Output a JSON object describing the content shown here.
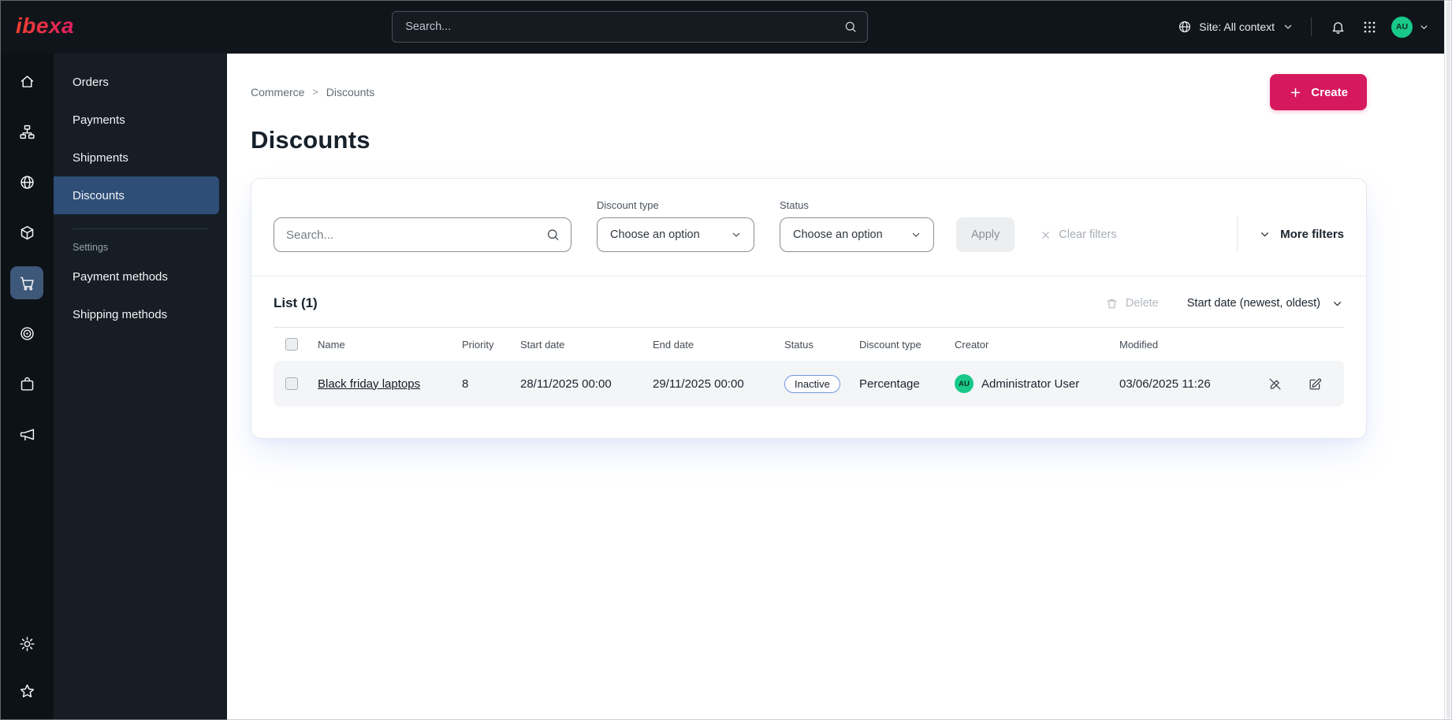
{
  "topbar": {
    "logo": "ibexa",
    "search_placeholder": "Search...",
    "site_context": "Site: All context",
    "user_initials": "AU"
  },
  "sidebar": {
    "rail_icons": [
      "home-icon",
      "sitemap-icon",
      "globe-icon",
      "box-icon",
      "cart-icon",
      "target-icon",
      "bag-icon",
      "megaphone-icon",
      "gear-icon",
      "star-icon"
    ],
    "active_icon": "cart-icon",
    "menu": {
      "items": [
        "Orders",
        "Payments",
        "Shipments",
        "Discounts"
      ],
      "active_item": "Discounts",
      "section_label": "Settings",
      "section_items": [
        "Payment methods",
        "Shipping methods"
      ]
    }
  },
  "main": {
    "breadcrumb": {
      "items": [
        "Commerce",
        "Discounts"
      ],
      "separator": ">"
    },
    "create_button": "Create",
    "page_title": "Discounts",
    "filters": {
      "search_placeholder": "Search...",
      "discount_type": {
        "label": "Discount type",
        "value": "Choose an option"
      },
      "status": {
        "label": "Status",
        "value": "Choose an option"
      },
      "apply_button": "Apply",
      "clear_button": "Clear filters",
      "more_filters": "More filters"
    },
    "list": {
      "title": "List (1)",
      "delete_button": "Delete",
      "sort_by": "Start date (newest, oldest)",
      "columns": [
        "Name",
        "Priority",
        "Start date",
        "End date",
        "Status",
        "Discount type",
        "Creator",
        "Modified"
      ],
      "rows": [
        {
          "name": "Black friday laptops",
          "priority": "8",
          "start_date": "28/11/2025 00:00",
          "end_date": "29/11/2025 00:00",
          "status": "Inactive",
          "discount_type": "Percentage",
          "creator_initials": "AU",
          "creator": "Administrator User",
          "modified": "03/06/2025 11:26"
        }
      ]
    }
  },
  "colors": {
    "brand": "#d6185e",
    "topbar_bg": "#10151b",
    "active_menu": "#2e4e78",
    "avatar_green": "#18c98a",
    "status_badge_border": "#6d95dd"
  }
}
